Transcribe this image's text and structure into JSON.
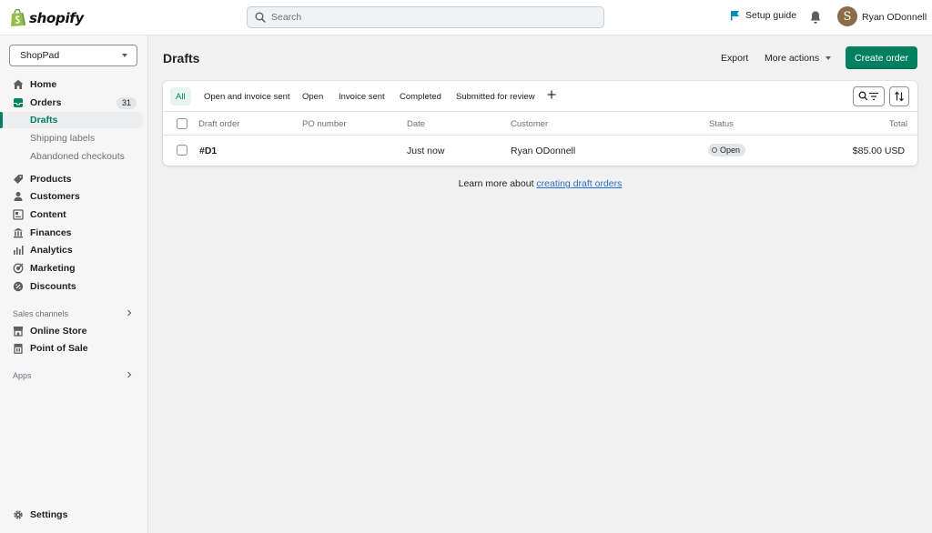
{
  "topbar": {
    "logo_text": "shopify",
    "search_placeholder": "Search",
    "setup_guide": "Setup guide",
    "avatar_initial": "S",
    "user_name": "Ryan ODonnell"
  },
  "sidebar": {
    "store_name": "ShopPad",
    "nav": [
      {
        "label": "Home",
        "icon": "home-icon"
      },
      {
        "label": "Orders",
        "icon": "orders-icon",
        "badge": "31"
      },
      {
        "label": "Products",
        "icon": "tag-icon"
      },
      {
        "label": "Customers",
        "icon": "person-icon"
      },
      {
        "label": "Content",
        "icon": "content-icon"
      },
      {
        "label": "Finances",
        "icon": "bank-icon"
      },
      {
        "label": "Analytics",
        "icon": "bar-chart-icon"
      },
      {
        "label": "Marketing",
        "icon": "target-icon"
      },
      {
        "label": "Discounts",
        "icon": "discount-icon"
      }
    ],
    "orders_sub": [
      {
        "label": "Drafts"
      },
      {
        "label": "Shipping labels"
      },
      {
        "label": "Abandoned checkouts"
      }
    ],
    "sales_channels_label": "Sales channels",
    "channels": [
      {
        "label": "Online Store",
        "icon": "store-icon"
      },
      {
        "label": "Point of Sale",
        "icon": "pos-icon"
      }
    ],
    "apps_label": "Apps",
    "settings_label": "Settings"
  },
  "main": {
    "title": "Drafts",
    "export": "Export",
    "more_actions": "More actions",
    "create_order": "Create order",
    "tabs": [
      "All",
      "Open and invoice sent",
      "Open",
      "Invoice sent",
      "Completed",
      "Submitted for review"
    ],
    "columns": [
      "Draft order",
      "PO number",
      "Date",
      "Customer",
      "Status",
      "Total"
    ],
    "rows": [
      {
        "draft_order": "#D1",
        "po_number": "",
        "date": "Just now",
        "customer": "Ryan ODonnell",
        "status": "Open",
        "total": "$85.00 USD"
      }
    ],
    "learn_more_prefix": "Learn more about ",
    "learn_more_link": "creating draft orders"
  },
  "colors": {
    "accent": "#008060",
    "link": "#2c6ecb",
    "topbar_bg": "#ffffff",
    "page_bg": "#f1f1f1"
  }
}
